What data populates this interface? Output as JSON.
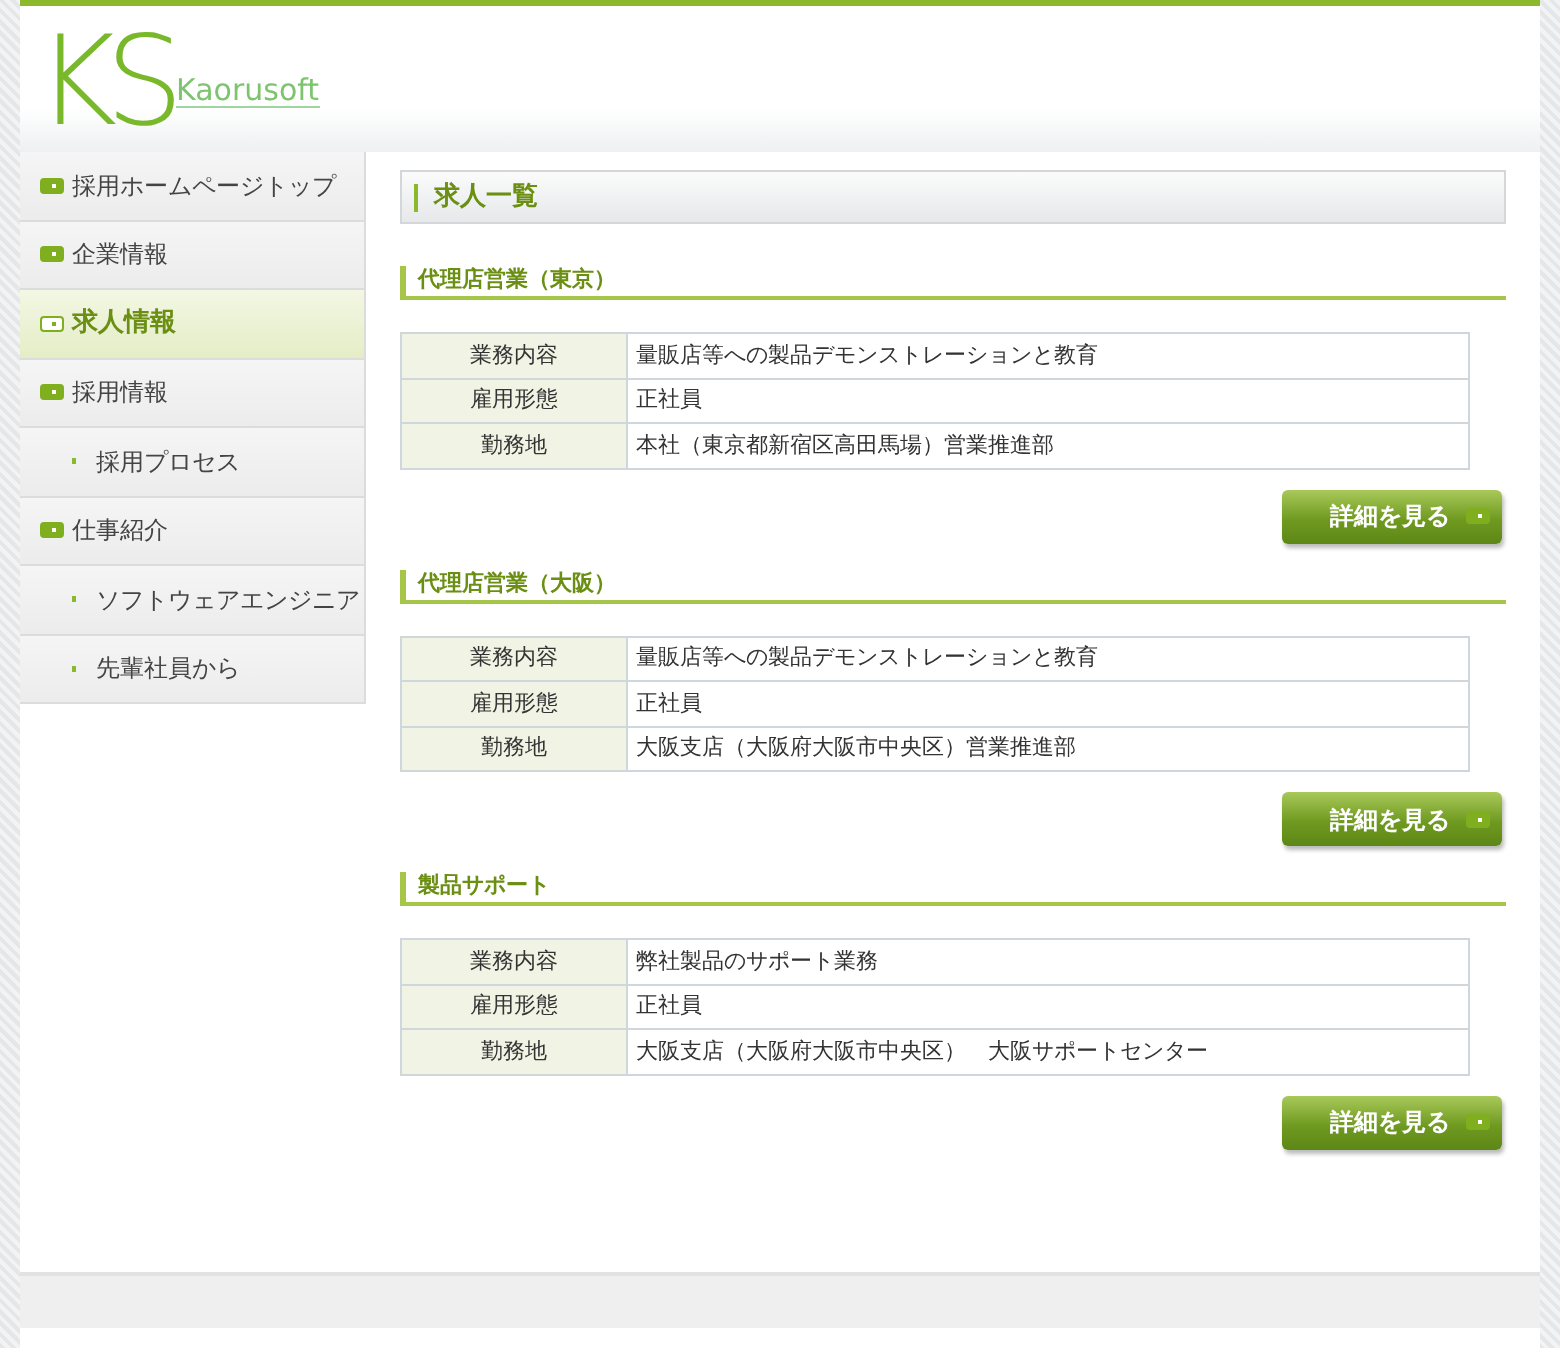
{
  "logo": {
    "mark": "KS",
    "name": "Kaorusoft"
  },
  "sidebar": {
    "items": [
      {
        "label": "採用ホームページトップ",
        "kind": "main",
        "selected": false
      },
      {
        "label": "企業情報",
        "kind": "main",
        "selected": false
      },
      {
        "label": "求人情報",
        "kind": "main",
        "selected": true
      },
      {
        "label": "採用情報",
        "kind": "main",
        "selected": false
      },
      {
        "label": "採用プロセス",
        "kind": "sub",
        "selected": false
      },
      {
        "label": "仕事紹介",
        "kind": "main",
        "selected": false
      },
      {
        "label": "ソフトウェアエンジニア",
        "kind": "sub",
        "selected": false
      },
      {
        "label": "先輩社員から",
        "kind": "sub",
        "selected": false
      }
    ]
  },
  "page_title": "求人一覧",
  "jobs": [
    {
      "title": "代理店営業（東京）",
      "rows": [
        {
          "label": "業務内容",
          "value": "量販店等への製品デモンストレーションと教育"
        },
        {
          "label": "雇用形態",
          "value": "正社員"
        },
        {
          "label": "勤務地",
          "value": "本社（東京都新宿区高田馬場）営業推進部"
        }
      ],
      "button": "詳細を見る"
    },
    {
      "title": "代理店営業（大阪）",
      "rows": [
        {
          "label": "業務内容",
          "value": "量販店等への製品デモンストレーションと教育"
        },
        {
          "label": "雇用形態",
          "value": "正社員"
        },
        {
          "label": "勤務地",
          "value": "大阪支店（大阪府大阪市中央区）営業推進部"
        }
      ],
      "button": "詳細を見る"
    },
    {
      "title": "製品サポート",
      "rows": [
        {
          "label": "業務内容",
          "value": "弊社製品のサポート業務"
        },
        {
          "label": "雇用形態",
          "value": "正社員"
        },
        {
          "label": "勤務地",
          "value": "大阪支店（大阪府大阪市中央区）　大阪サポートセンター"
        }
      ],
      "button": "詳細を見る"
    }
  ]
}
